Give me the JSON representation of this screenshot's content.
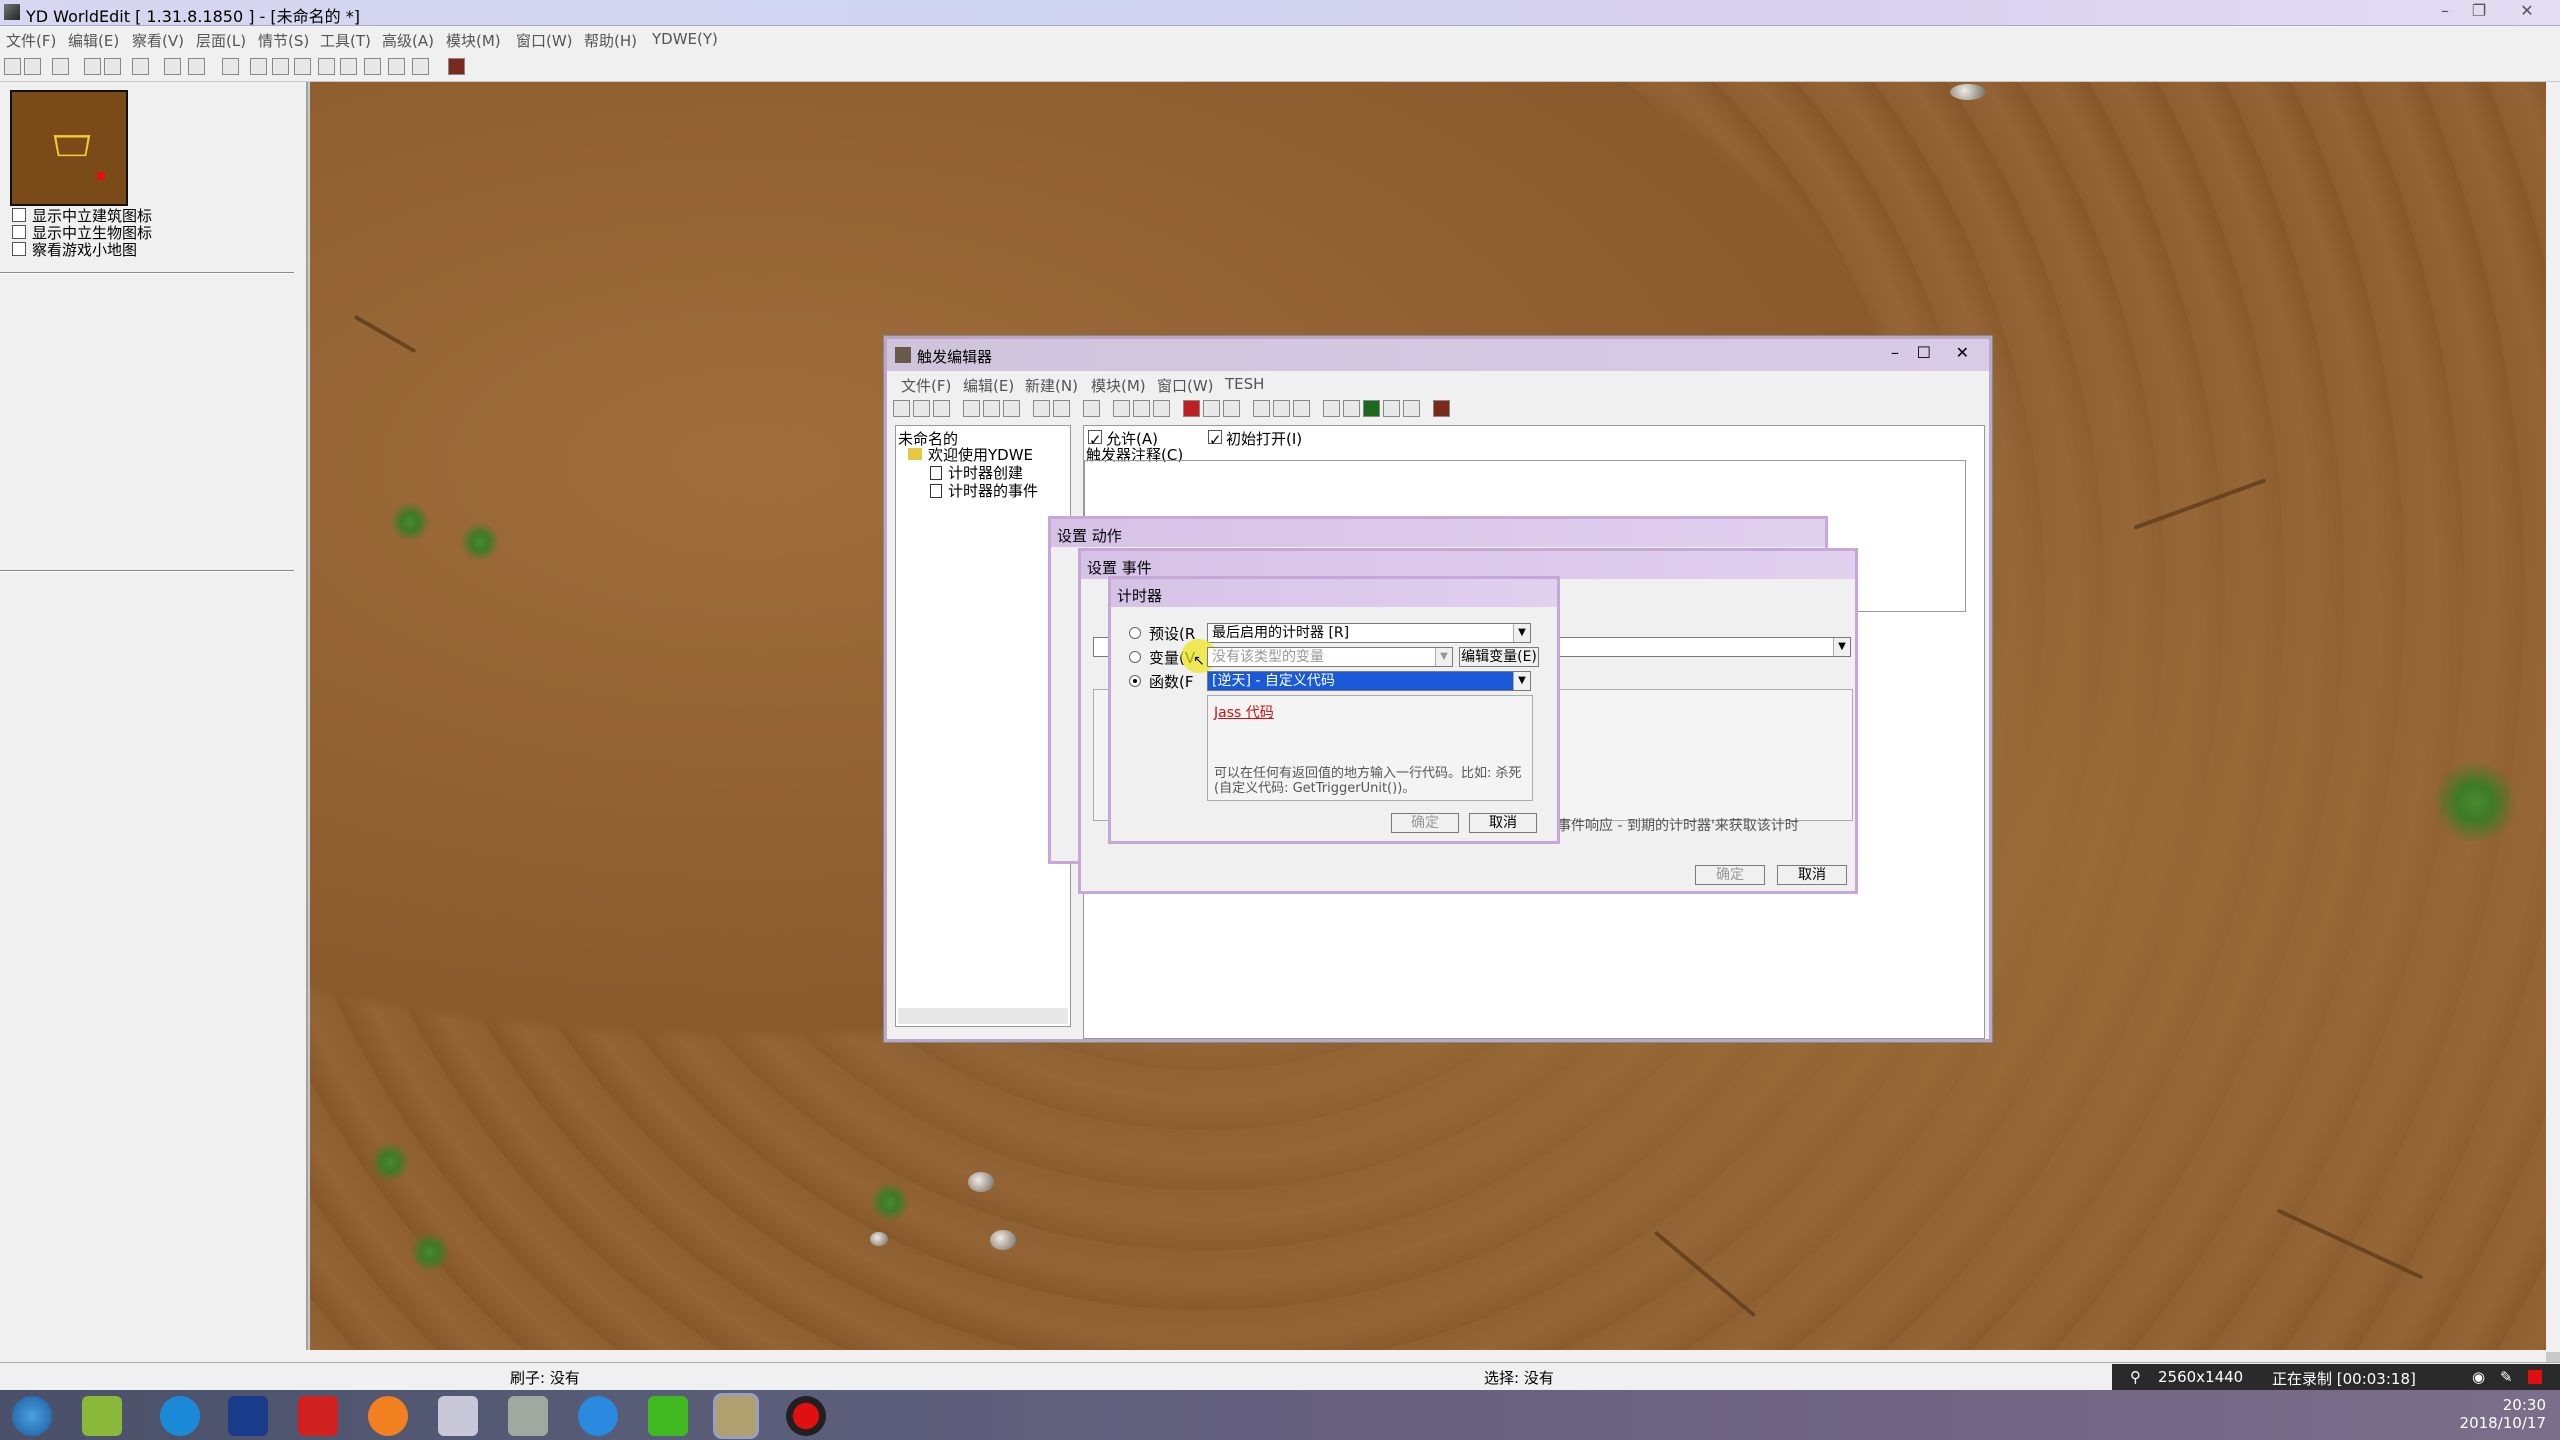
{
  "app": {
    "title": "YD WorldEdit [ 1.31.8.1850 ] - [未命名的 *]",
    "menu": [
      "文件(F)",
      "编辑(E)",
      "察看(V)",
      "层面(L)",
      "情节(S)",
      "工具(T)",
      "高级(A)",
      "模块(M)",
      "窗口(W)",
      "帮助(H)",
      "YDWE(Y)"
    ],
    "left_panel": {
      "options": [
        "显示中立建筑图标",
        "显示中立生物图标",
        "察看游戏小地图"
      ]
    },
    "status": {
      "brush": "刷子: 没有",
      "selection": "选择: 没有"
    }
  },
  "trigger_editor": {
    "title": "触发编辑器",
    "menu": [
      "文件(F)",
      "编辑(E)",
      "新建(N)",
      "模块(M)",
      "窗口(W)",
      "TESH"
    ],
    "tree": {
      "root": "未命名的",
      "category": "欢迎使用YDWE",
      "items": [
        "计时器创建",
        "计时器的事件"
      ]
    },
    "enabled_label": "允许(A)",
    "initially_on_label": "初始打开(I)",
    "comment_label": "触发器注释(C)"
  },
  "action_dialog": {
    "title": "设置 动作"
  },
  "event_dialog": {
    "title": "设置 事件",
    "hint": "事件响应 - 到期的计时器'来获取该计时",
    "ok": "确定",
    "cancel": "取消"
  },
  "timer_dialog": {
    "title": "计时器",
    "preset_label": "预设(R",
    "preset_value": "最后启用的计时器 [R]",
    "variable_label": "变量(V",
    "variable_value": "没有该类型的变量",
    "edit_variable": "编辑变量(E)",
    "function_label": "函数(F",
    "function_value": "[逆天] - 自定义代码",
    "jass_link": "Jass 代码",
    "description": "可以在任何有返回值的地方输入一行代码。比如: 杀死(自定义代码: GetTriggerUnit())。",
    "ok": "确定",
    "cancel": "取消"
  },
  "recorder": {
    "resolution": "2560x1440",
    "status": "正在录制 [00:03:18]"
  },
  "clock": {
    "time": "20:30",
    "date": "2018/10/17"
  }
}
